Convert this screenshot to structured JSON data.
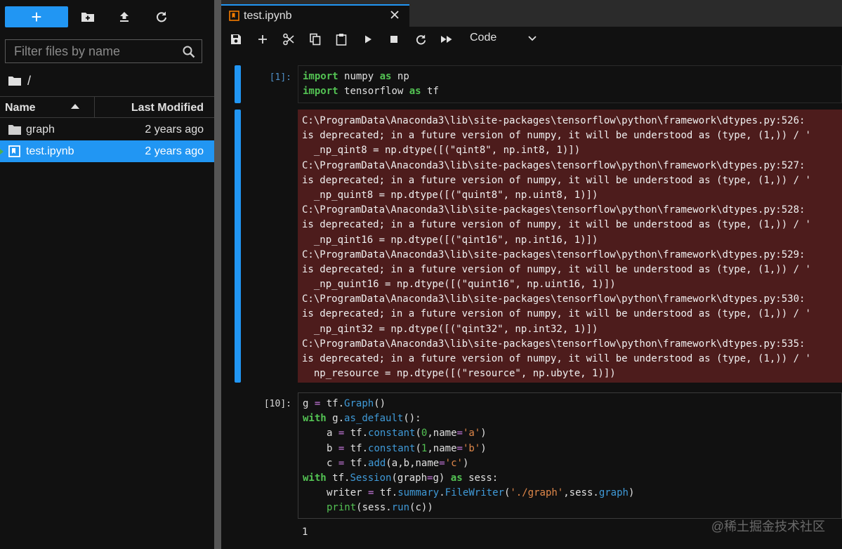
{
  "sidebar": {
    "new_launcher_label": "+",
    "filter": {
      "placeholder": "Filter files by name",
      "value": ""
    },
    "breadcrumb": "/",
    "headers": {
      "name": "Name",
      "last_modified": "Last Modified"
    },
    "files": [
      {
        "name": "graph",
        "modified": "2 years ago",
        "icon": "folder-icon"
      },
      {
        "name": "test.ipynb",
        "modified": "2 years ago",
        "icon": "notebook-icon"
      }
    ]
  },
  "tab": {
    "title": "test.ipynb"
  },
  "toolbar": {
    "cell_type": "Code"
  },
  "cells": {
    "c1": {
      "prompt": "[1]:",
      "line1": {
        "kw1": "import",
        "mod": "numpy",
        "kw2": "as",
        "alias": "np"
      },
      "line2": {
        "kw1": "import",
        "mod": "tensorflow",
        "kw2": "as",
        "alias": "tf"
      }
    },
    "stderr": [
      "C:\\ProgramData\\Anaconda3\\lib\\site-packages\\tensorflow\\python\\framework\\dtypes.py:526:",
      "is deprecated; in a future version of numpy, it will be understood as (type, (1,)) / '",
      "  _np_qint8 = np.dtype([(\"qint8\", np.int8, 1)])",
      "C:\\ProgramData\\Anaconda3\\lib\\site-packages\\tensorflow\\python\\framework\\dtypes.py:527:",
      "is deprecated; in a future version of numpy, it will be understood as (type, (1,)) / '",
      "  _np_quint8 = np.dtype([(\"quint8\", np.uint8, 1)])",
      "C:\\ProgramData\\Anaconda3\\lib\\site-packages\\tensorflow\\python\\framework\\dtypes.py:528:",
      "is deprecated; in a future version of numpy, it will be understood as (type, (1,)) / '",
      "  _np_qint16 = np.dtype([(\"qint16\", np.int16, 1)])",
      "C:\\ProgramData\\Anaconda3\\lib\\site-packages\\tensorflow\\python\\framework\\dtypes.py:529:",
      "is deprecated; in a future version of numpy, it will be understood as (type, (1,)) / '",
      "  _np_quint16 = np.dtype([(\"quint16\", np.uint16, 1)])",
      "C:\\ProgramData\\Anaconda3\\lib\\site-packages\\tensorflow\\python\\framework\\dtypes.py:530:",
      "is deprecated; in a future version of numpy, it will be understood as (type, (1,)) / '",
      "  _np_qint32 = np.dtype([(\"qint32\", np.int32, 1)])",
      "C:\\ProgramData\\Anaconda3\\lib\\site-packages\\tensorflow\\python\\framework\\dtypes.py:535:",
      "is deprecated; in a future version of numpy, it will be understood as (type, (1,)) / '",
      "  np_resource = np.dtype([(\"resource\", np.ubyte, 1)])"
    ],
    "c2": {
      "prompt": "[10]:",
      "t": {
        "g": "g",
        "eq": "=",
        "tf": "tf",
        "dot": ".",
        "Graph": "Graph",
        "paren": "()",
        "with": "with",
        "as_default": "as_default",
        "paren_colon": "():",
        "a": "a",
        "b": "b",
        "c": "c",
        "constant": "constant",
        "add": "add",
        "n0": "0",
        "n1": "1",
        "comma": ",",
        "name": "name",
        "qa": "'a'",
        "qb": "'b'",
        "qc": "'c'",
        "lp": "(",
        "rp": ")",
        "ab_args": "a,b,",
        "Session": "Session",
        "graph_arg": "(graph",
        "g_close": "g)",
        "as": "as",
        "sess_colon": "sess:",
        "writer": "writer",
        "summary": "summary",
        "FileWriter": "FileWriter",
        "path": "'./graph'",
        "sess_graph_pre": ",sess.",
        "graph": "graph",
        "print": "print",
        "sess_run": "(sess.",
        "run": "run",
        "c_close": "(c))"
      },
      "output": "1"
    }
  },
  "watermark": "@稀土掘金技术社区",
  "colors": {
    "accent": "#2196f3",
    "stderr_bg": "#4d1c1c",
    "keyword": "#53c253"
  }
}
